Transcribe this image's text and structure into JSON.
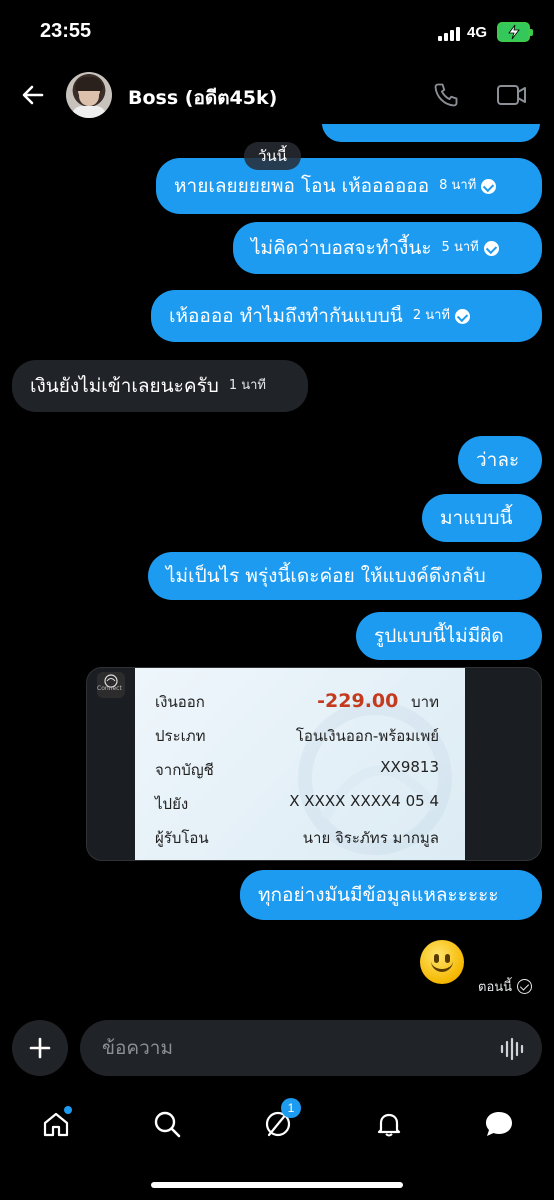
{
  "status_bar": {
    "time": "23:55",
    "network": "4G"
  },
  "header": {
    "contact_name": "Boss (อดีต45k)"
  },
  "chat": {
    "date_separator": "วันนี้",
    "messages": [
      {
        "direction": "out",
        "text": "หายเลยยยยพอ โอน เห้ออออออ",
        "time": "8 นาที",
        "read": true
      },
      {
        "direction": "out",
        "text": "ไม่คิดว่าบอสจะทำงี้นะ",
        "time": "5 นาที",
        "read": true
      },
      {
        "direction": "out",
        "text": "เห้ออออ  ทำไมถึงทำกันแบบนี้",
        "time": "2 นาที",
        "read": true
      },
      {
        "direction": "in",
        "text": "เงินยังไม่เข้าเลยนะครับ",
        "time": "1 นาที"
      },
      {
        "direction": "out",
        "text": "ว่าละ"
      },
      {
        "direction": "out",
        "text": "มาแบบนี้"
      },
      {
        "direction": "out",
        "text": "ไม่เป็นไร พรุ่งนี้เดะค่อย ให้แบงค์ดึงกลับ"
      },
      {
        "direction": "out",
        "text": "รูปแบบนี้ไม่มีผิด"
      },
      {
        "direction": "out",
        "text": "ทุกอย่างมันมีข้อมูลแหละะะะะ"
      }
    ],
    "slip": {
      "logo_text": "Connect",
      "rows": [
        {
          "label": "เงินออก",
          "value": "-229.00",
          "unit": "บาท"
        },
        {
          "label": "ประเภท",
          "value": "โอนเงินออก-พร้อมเพย์"
        },
        {
          "label": "จากบัญชี",
          "value": "XX9813"
        },
        {
          "label": "ไปยัง",
          "value": "X XXXX XXXX4 05 4"
        },
        {
          "label": "ผู้รับโอน",
          "value": "นาย จิระภัทร มากมูล"
        }
      ]
    },
    "last_status": "ตอนนี้"
  },
  "composer": {
    "placeholder": "ข้อความ"
  },
  "nav": {
    "messages_badge": "1"
  },
  "colors": {
    "accent": "#1d9bf0",
    "incoming_bubble": "#202327",
    "background": "#000000",
    "amount_red": "#c43a1c"
  }
}
